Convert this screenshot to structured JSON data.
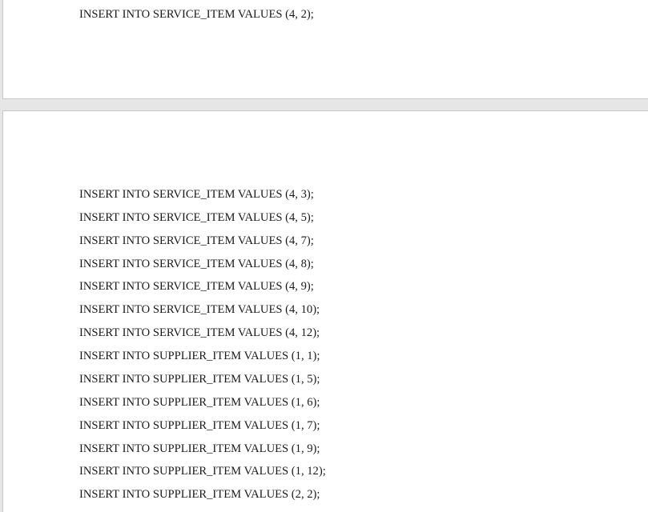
{
  "pages": [
    {
      "lines": [
        "INSERT INTO SERVICE_ITEM VALUES (4, 2);"
      ]
    },
    {
      "lines": [
        "INSERT INTO SERVICE_ITEM VALUES (4, 3);",
        "INSERT INTO SERVICE_ITEM VALUES (4, 5);",
        "INSERT INTO SERVICE_ITEM VALUES (4, 7);",
        "INSERT INTO SERVICE_ITEM VALUES (4, 8);",
        "INSERT INTO SERVICE_ITEM VALUES (4, 9);",
        "INSERT INTO SERVICE_ITEM VALUES (4, 10);",
        "INSERT INTO SERVICE_ITEM VALUES (4, 12);",
        "INSERT INTO SUPPLIER_ITEM VALUES (1, 1);",
        "INSERT INTO SUPPLIER_ITEM VALUES (1, 5);",
        "INSERT INTO SUPPLIER_ITEM VALUES (1, 6);",
        "INSERT INTO SUPPLIER_ITEM VALUES (1, 7);",
        "INSERT INTO SUPPLIER_ITEM VALUES (1, 9);",
        "INSERT INTO SUPPLIER_ITEM VALUES (1, 12);",
        "INSERT INTO SUPPLIER_ITEM VALUES (2, 2);"
      ]
    }
  ]
}
